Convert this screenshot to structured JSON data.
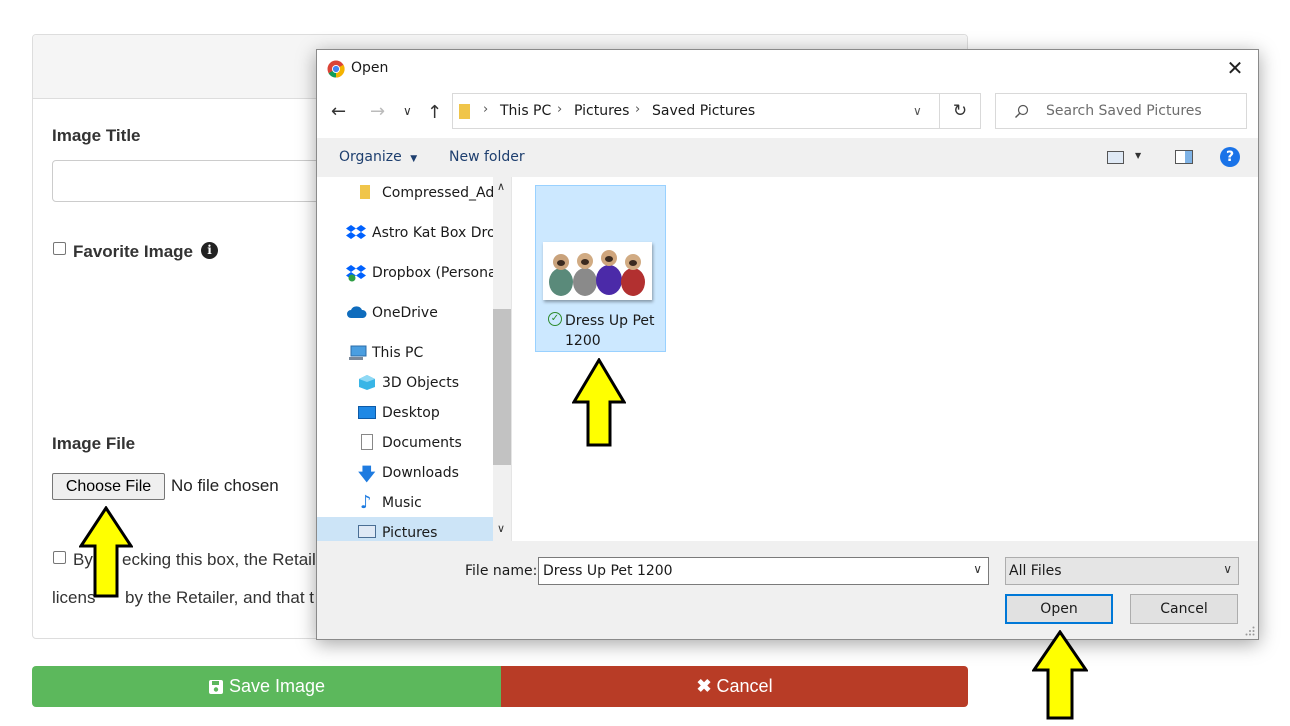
{
  "form": {
    "image_title_label": "Image Title",
    "favorite_label": "Favorite Image",
    "info_icon": "i",
    "image_file_label": "Image File",
    "choose_file_label": "Choose File",
    "no_file_text": "No file chosen",
    "agree_line1_a": "By",
    "agree_line1_b": "ecking this box, the Retail",
    "agree_line2_a": "licens",
    "agree_line2_b": "by the Retailer, and that t",
    "save_label": "Save Image",
    "cancel_label": "Cancel",
    "save_color": "#5cb85c",
    "cancel_color": "#b83c26"
  },
  "dialog": {
    "title": "Open",
    "breadcrumb": [
      "This PC",
      "Pictures",
      "Saved Pictures"
    ],
    "search_placeholder": "Search Saved Pictures",
    "toolbar": {
      "organize": "Organize",
      "new_folder": "New folder",
      "help": "?"
    },
    "nav_items": [
      {
        "label": "Compressed_Ad",
        "icon": "folder-icon"
      },
      {
        "label": "Astro Kat Box Dro",
        "icon": "dropbox-icon"
      },
      {
        "label": "Dropbox (Persona",
        "icon": "dropbox-icon"
      },
      {
        "label": "OneDrive",
        "icon": "cloud-icon"
      },
      {
        "label": "This PC",
        "icon": "computer-icon"
      },
      {
        "label": "3D Objects",
        "icon": "cube-icon"
      },
      {
        "label": "Desktop",
        "icon": "desktop-icon"
      },
      {
        "label": "Documents",
        "icon": "document-icon"
      },
      {
        "label": "Downloads",
        "icon": "download-icon"
      },
      {
        "label": "Music",
        "icon": "music-icon"
      },
      {
        "label": "Pictures",
        "icon": "pictures-icon"
      }
    ],
    "file": {
      "line1": "Dress Up Pet",
      "line2": "1200"
    },
    "file_name_label": "File name:",
    "file_name_value": "Dress Up Pet 1200",
    "file_type_value": "All Files",
    "open_label": "Open",
    "cancel_label": "Cancel",
    "accent": "#0078d7"
  },
  "annotations": {
    "arrow_color": "#ffff00"
  }
}
